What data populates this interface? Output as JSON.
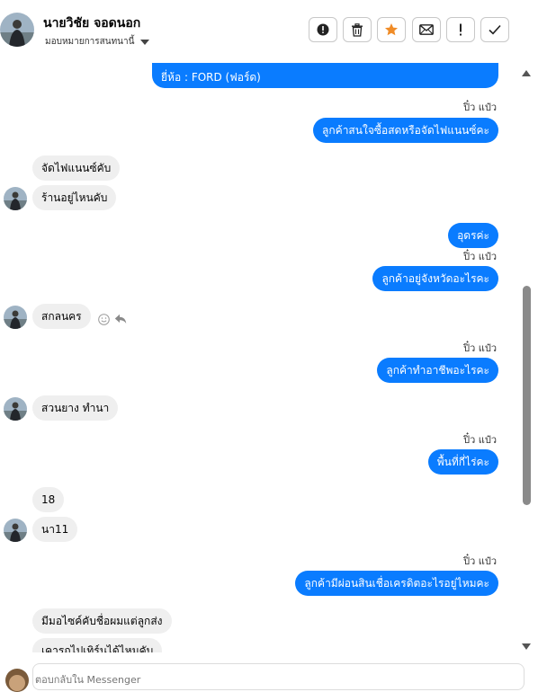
{
  "header": {
    "name": "นายวิชัย จอดนอก",
    "assign_label": "มอบหมายการสนทนานี้",
    "buttons": [
      {
        "icon": "alert-circle-icon"
      },
      {
        "icon": "trash-icon"
      },
      {
        "icon": "star-icon"
      },
      {
        "icon": "envelope-icon"
      },
      {
        "icon": "exclamation-icon"
      },
      {
        "icon": "checkmark-icon"
      }
    ]
  },
  "colors": {
    "outgoing": "#0a7cff",
    "incoming": "#efefef",
    "star": "#f08c27"
  },
  "messages": {
    "top_partial": "ยี่ห้อ : FORD (ฟอร์ด)",
    "seen_label": "ปิ๋ว แป๋ว",
    "m1": "ลูกค้าสนใจซื้อสดหรือจัดไฟแนนซ์คะ",
    "m2": "จัดไฟแนนซ์คับ",
    "m3": "ร้านอยู่ไหนคับ",
    "m4": "อุดรค่ะ",
    "m5": "ลูกค้าอยู่จังหวัดอะไรคะ",
    "m6": "สกลนคร",
    "m7": "ลูกค้าทำอาชีพอะไรคะ",
    "m8": "สวนยาง ทำนา",
    "m9": "พื้นที่กี่ไร่คะ",
    "m10": "18",
    "m11": "นา11",
    "m12": "ลูกค้ามีผ่อนสินเชื่อเครดิตอะไรอยู่ไหมคะ",
    "m13": "มีมอไซค์คับชื่อผมแต่ลูกส่ง",
    "m14": "เคารถไปเทิร์นได้ไหมคับ"
  },
  "composer": {
    "placeholder": "ตอบกลับใน Messenger"
  }
}
